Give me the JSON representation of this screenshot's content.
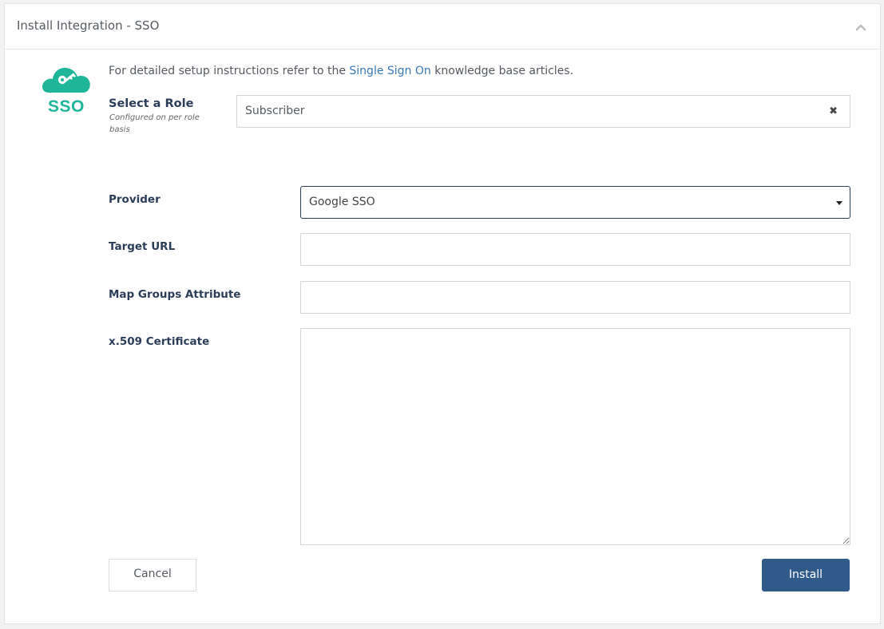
{
  "header": {
    "title": "Install Integration - SSO",
    "collapse_icon": "chevron-up-icon"
  },
  "logo": {
    "icon": "cloud-key-icon",
    "text": "SSO",
    "color": "#1fb599"
  },
  "intro": {
    "prefix": "For detailed setup instructions refer to the ",
    "link_text": "Single Sign On",
    "suffix": " knowledge base articles."
  },
  "role": {
    "label": "Select a Role",
    "sublabel": "Configured on per role basis",
    "value": "Subscriber",
    "clear_icon": "close-icon"
  },
  "form": {
    "provider_label": "Provider",
    "provider_value": "Google SSO",
    "target_url_label": "Target URL",
    "target_url_value": "",
    "map_groups_label": "Map Groups Attribute",
    "map_groups_value": "",
    "certificate_label": "x.509 Certificate",
    "certificate_value": ""
  },
  "actions": {
    "cancel_label": "Cancel",
    "install_label": "Install",
    "install_color": "#2f5a8a"
  }
}
